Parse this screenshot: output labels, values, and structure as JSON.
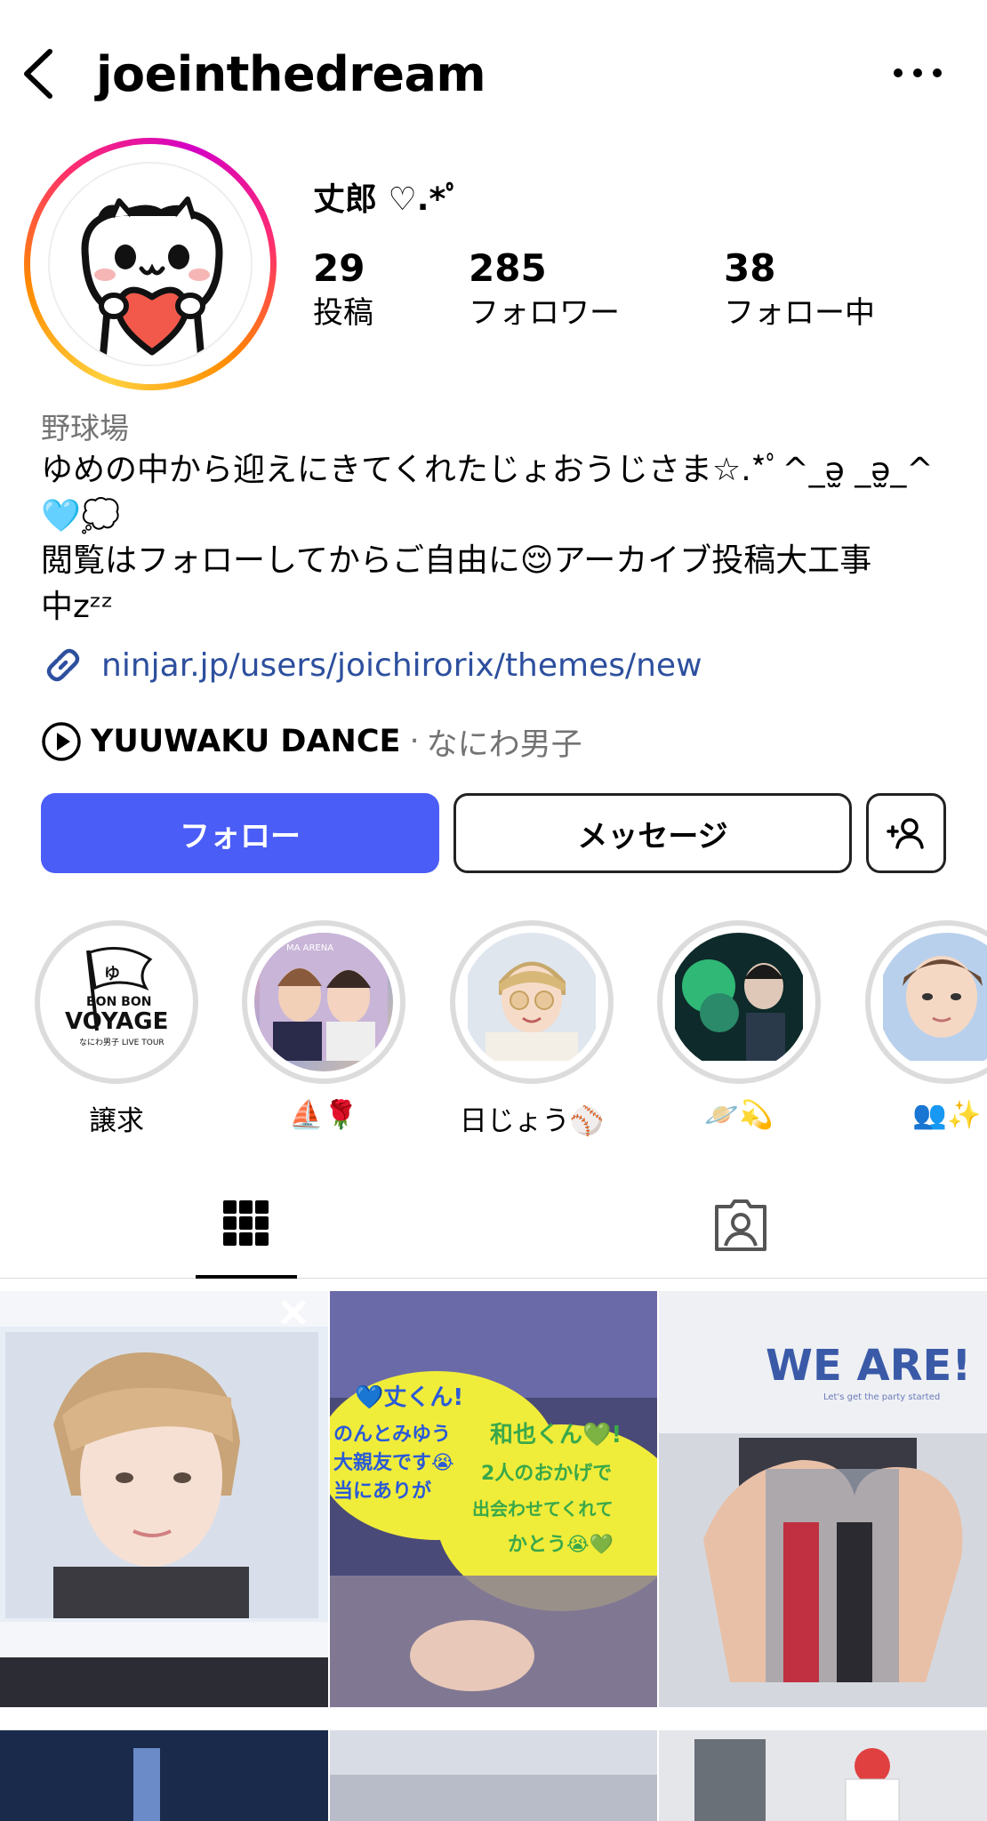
{
  "header": {
    "username": "joeinthedream",
    "back_icon": "chevron-left-icon",
    "more_icon": "more-horizontal-icon"
  },
  "profile": {
    "display_name": "丈郎 ♡.*ﾟ",
    "stats": [
      {
        "value": "29",
        "label": "投稿"
      },
      {
        "value": "285",
        "label": "フォロワー"
      },
      {
        "value": "38",
        "label": "フォロー中"
      }
    ]
  },
  "bio": {
    "category": "野球場",
    "line1": "ゆめの中から迎えにきてくれたじょおうじさま☆.*ﾟ^_ə̫ _ə̫_^",
    "line2": "🩵💭",
    "line3": "閲覧はフォローしてからご自由に😌アーカイブ投稿大工事",
    "line4": "中zᶻᶻ",
    "link": "ninjar.jp/users/joichirorix/themes/new",
    "link_icon": "link-icon"
  },
  "music": {
    "icon": "play-icon",
    "title": "YUUWAKU DANCE",
    "separator": "·",
    "artist": "なにわ男子"
  },
  "actions": {
    "follow_label": "フォロー",
    "message_label": "メッセージ",
    "add_user_icon": "add-user-icon"
  },
  "highlights": [
    {
      "label": "譲求"
    },
    {
      "label": "⛵🌹"
    },
    {
      "label": "日じょう⚾"
    },
    {
      "label": "🪐💫"
    },
    {
      "label": "👥✨"
    }
  ],
  "highlight_texts": {
    "h1_bon": "BON BON",
    "h1_voyage": "VOYAGE",
    "h1_sub": "なにわ男子 LIVE TOUR",
    "h2_arena": "MA ARENA"
  },
  "tabs": {
    "grid_icon": "grid-icon",
    "tagged_icon": "tagged-person-icon"
  },
  "posts": {
    "p2_fan1": "💙丈くん!",
    "p2_fan1b": "のんとみゆう",
    "p2_fan1c": "大親友です😭",
    "p2_fan1d": "当にありが",
    "p2_fan2": "和也くん💚!",
    "p2_fan2b": "2人のおかげで",
    "p2_fan2c": "出会わせてくれて",
    "p2_fan2d": "かとう😭💚",
    "p3_title": "WE ARE!",
    "p3_sub": "Let's get the party started"
  },
  "colors": {
    "follow_button": "#4a5df7",
    "link": "#2d4f9e",
    "secondary_text": "#737373"
  }
}
